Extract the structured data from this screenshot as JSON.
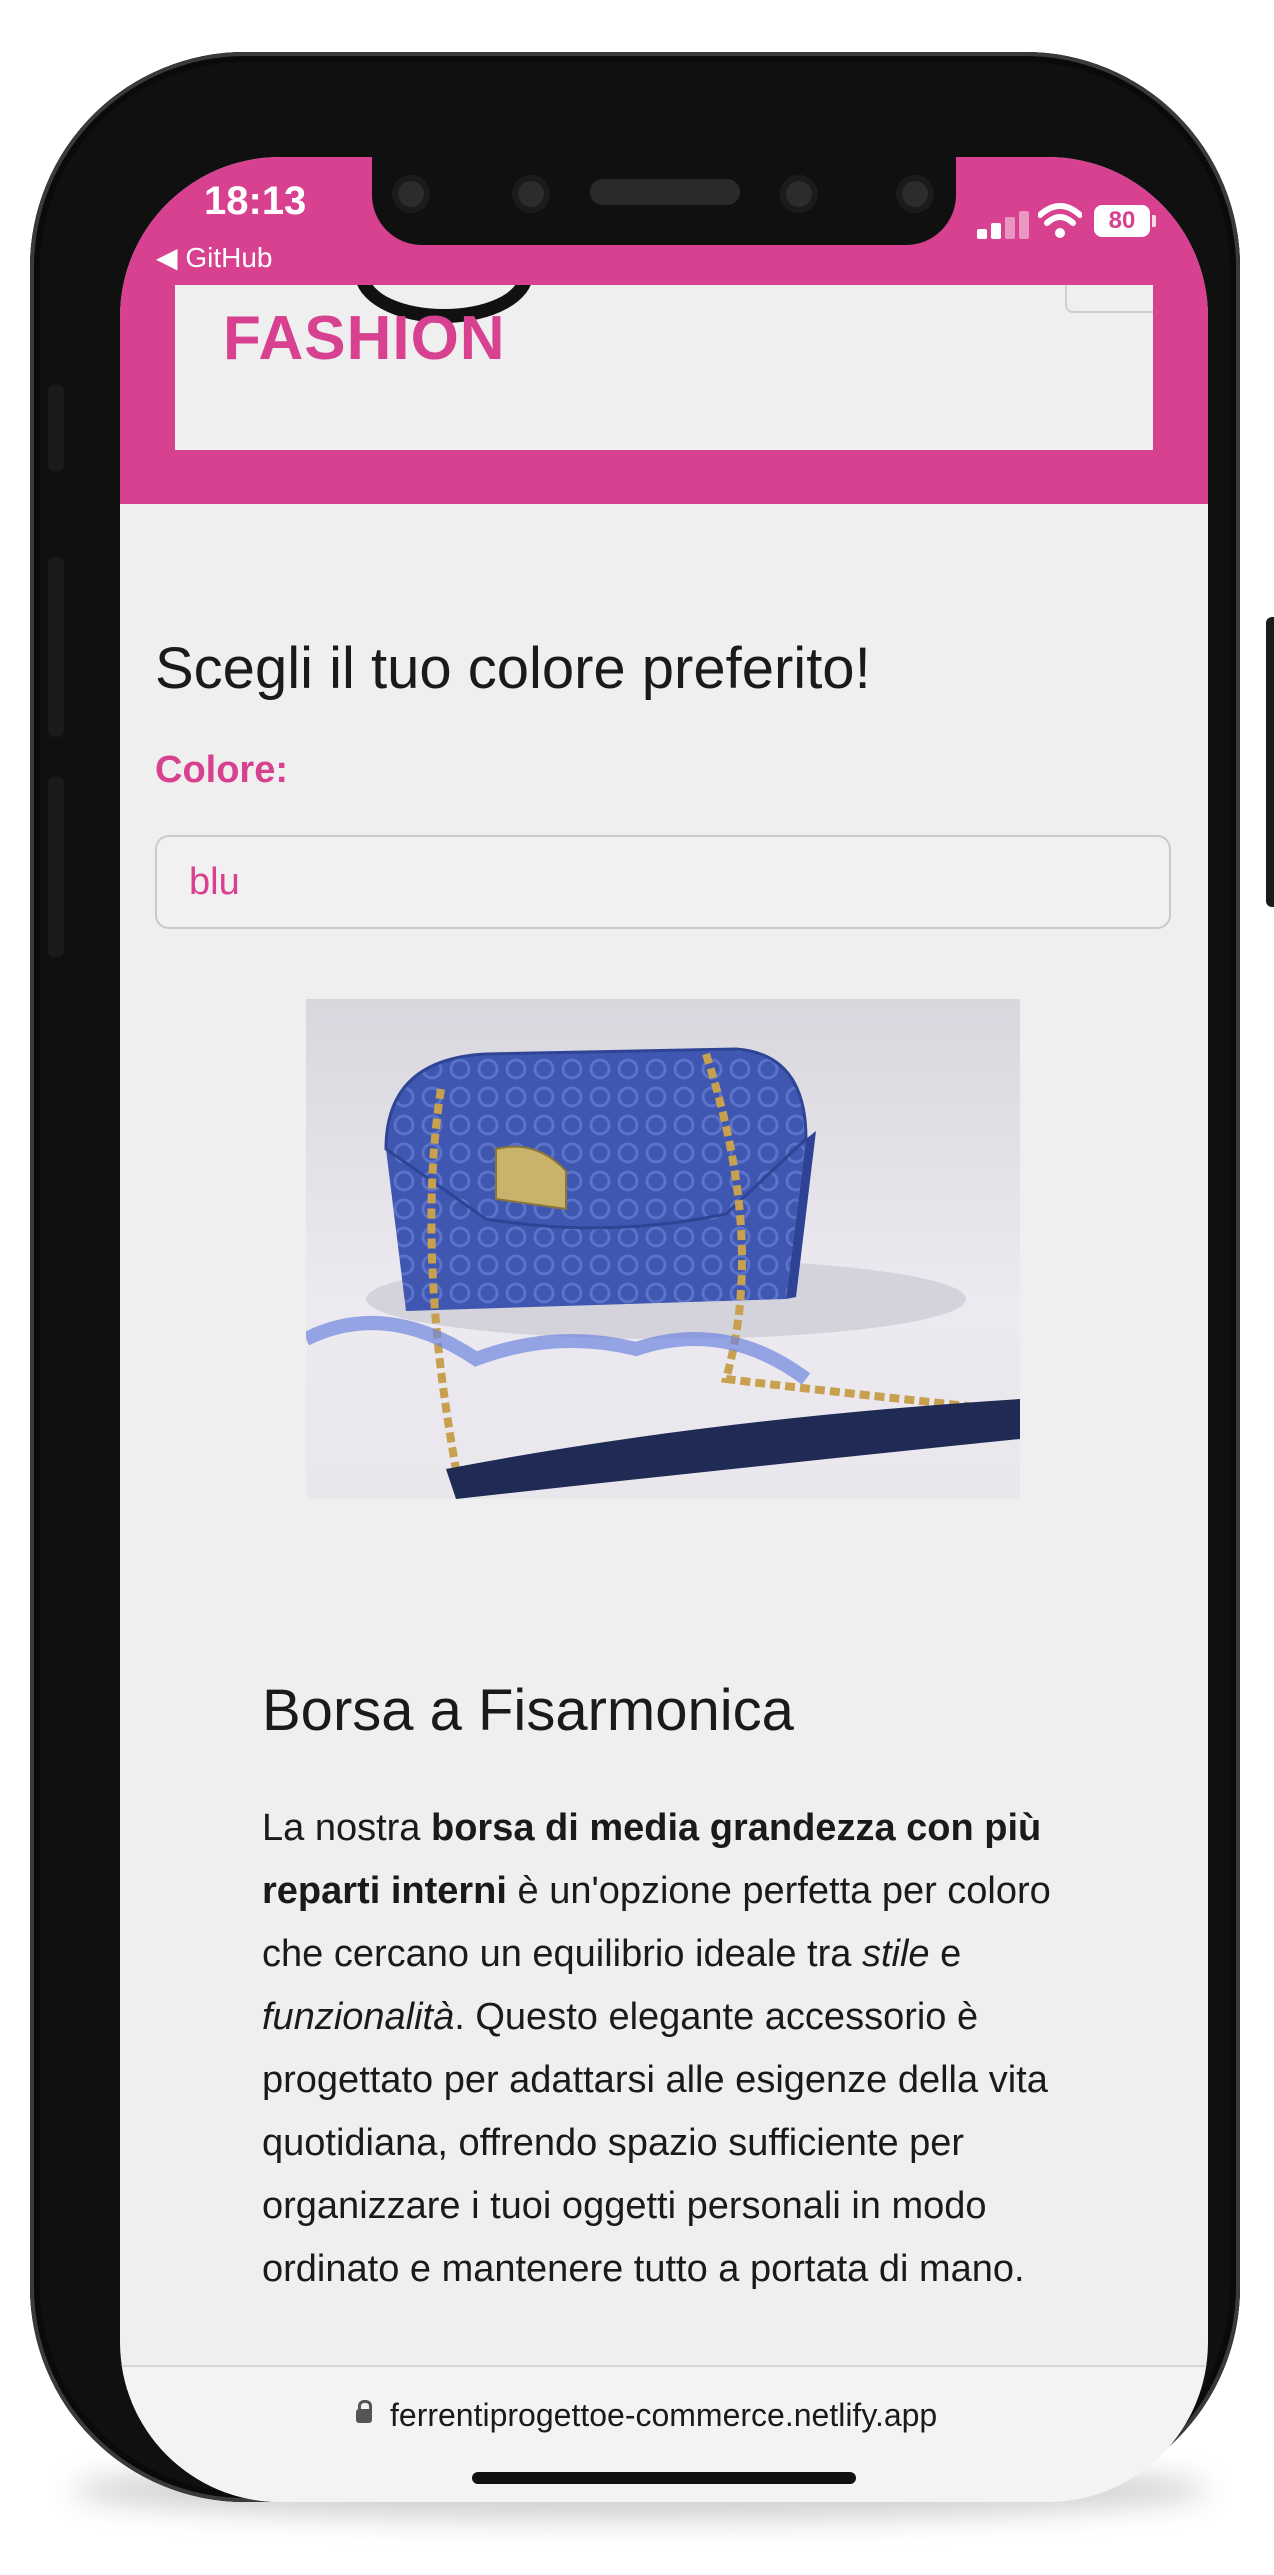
{
  "status_bar": {
    "time": "18:13",
    "back_app": "◀ GitHub",
    "battery": "80"
  },
  "header": {
    "logo_text": "FASHION"
  },
  "main": {
    "title": "Scegli il tuo colore preferito!",
    "color_label": "Colore:",
    "color_select_value": "blu",
    "product_image_alt": "Borsa blu",
    "product_name": "Borsa a Fisarmonica",
    "description": {
      "t1": "La nostra ",
      "b1": "borsa di media grandezza con più reparti interni",
      "t2": " è un'opzione perfetta per coloro che cercano un equilibrio ideale tra ",
      "i1": "stile",
      "t3": " e ",
      "i2": "funzionalità",
      "t4": ". Questo elegante accessorio è progettato per adattarsi alle esigenze della vita quotidiana, offrendo spazio sufficiente per organizzare i tuoi oggetti personali in modo ordinato e mantenere tutto a portata di mano."
    }
  },
  "url_bar": {
    "url": "ferrentiprogettoe-commerce.netlify.app"
  },
  "colors": {
    "brand": "#d7418f",
    "background": "#efeff0"
  }
}
